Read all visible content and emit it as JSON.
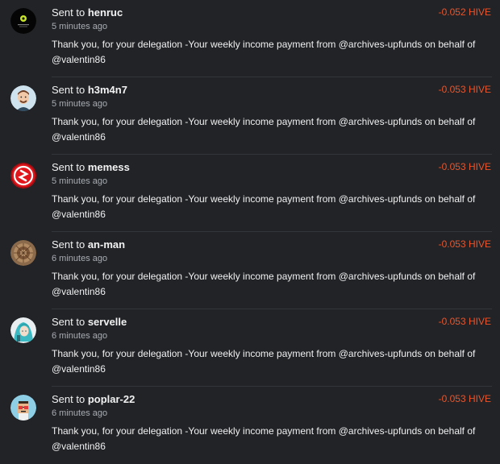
{
  "transfers": [
    {
      "prefix": "Sent to",
      "user": "henruc",
      "time": "5 minutes ago",
      "amount": "-0.052 HIVE",
      "memo": "Thank you, for your delegation -Your weekly income payment from @archives-upfunds on behalf of @valentin86",
      "avatar_icon": "black-badge-avatar"
    },
    {
      "prefix": "Sent to",
      "user": "h3m4n7",
      "time": "5 minutes ago",
      "amount": "-0.053 HIVE",
      "memo": "Thank you, for your delegation -Your weekly income payment from @archives-upfunds on behalf of @valentin86",
      "avatar_icon": "cartoon-man-avatar"
    },
    {
      "prefix": "Sent to",
      "user": "memess",
      "time": "5 minutes ago",
      "amount": "-0.053 HIVE",
      "memo": "Thank you, for your delegation -Your weekly income payment from @archives-upfunds on behalf of @valentin86",
      "avatar_icon": "red-logo-avatar"
    },
    {
      "prefix": "Sent to",
      "user": "an-man",
      "time": "6 minutes ago",
      "amount": "-0.053 HIVE",
      "memo": "Thank you, for your delegation -Your weekly income payment from @archives-upfunds on behalf of @valentin86",
      "avatar_icon": "brown-texture-avatar"
    },
    {
      "prefix": "Sent to",
      "user": "servelle",
      "time": "6 minutes ago",
      "amount": "-0.053 HIVE",
      "memo": "Thank you, for your delegation -Your weekly income payment from @archives-upfunds on behalf of @valentin86",
      "avatar_icon": "teal-hair-avatar"
    },
    {
      "prefix": "Sent to",
      "user": "poplar-22",
      "time": "6 minutes ago",
      "amount": "-0.053 HIVE",
      "memo": "Thank you, for your delegation -Your weekly income payment from @archives-upfunds on behalf of @valentin86",
      "avatar_icon": "pixel-character-avatar"
    }
  ],
  "colors": {
    "background": "#212327",
    "amount": "#e8552c",
    "muted": "#a9adb3",
    "divider": "#33363b"
  }
}
